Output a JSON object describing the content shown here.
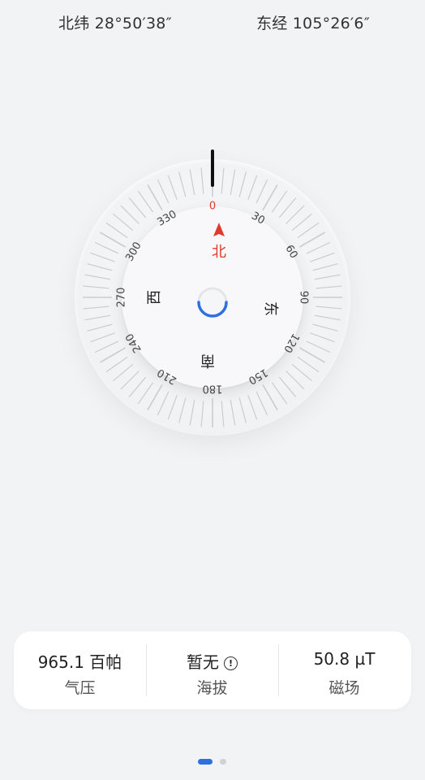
{
  "header": {
    "latitude": "北纬 28°50′38″",
    "longitude": "东经 105°26′6″"
  },
  "compass": {
    "heading_deg": 0,
    "degree_labels": [
      "0",
      "30",
      "60",
      "90",
      "120",
      "150",
      "180",
      "210",
      "240",
      "270",
      "300",
      "330"
    ],
    "cardinals": {
      "north": "北",
      "east": "东",
      "south": "南",
      "west": "西"
    },
    "colors": {
      "north": "#e03a2c",
      "accent": "#2f6fe0",
      "tick": "#c9ccd1"
    }
  },
  "info": {
    "pressure_value": "965.1 百帕",
    "pressure_label": "气压",
    "altitude_value": "暂无",
    "altitude_label": "海拔",
    "magnetic_value": "50.8 µT",
    "magnetic_label": "磁场",
    "info_icon": "info-icon"
  },
  "pager": {
    "pages": 2,
    "active": 1
  }
}
